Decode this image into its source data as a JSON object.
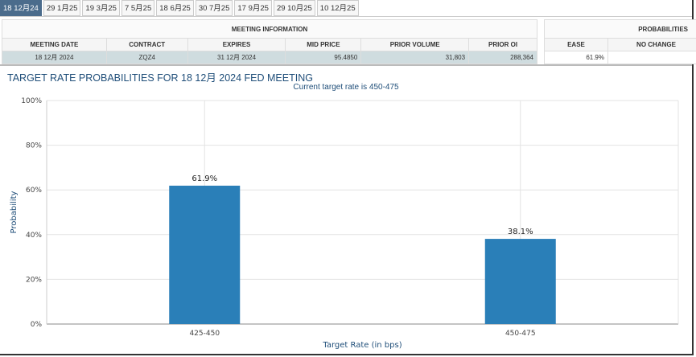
{
  "tabs": [
    "18 12月24",
    "29 1月25",
    "19 3月25",
    "7 5月25",
    "18 6月25",
    "30 7月25",
    "17 9月25",
    "29 10月25",
    "10 12月25"
  ],
  "meeting": {
    "group": "MEETING INFORMATION",
    "headers": [
      "MEETING DATE",
      "CONTRACT",
      "EXPIRES",
      "MID PRICE",
      "PRIOR VOLUME",
      "PRIOR OI"
    ],
    "row": [
      "18 12月 2024",
      "ZQZ4",
      "31 12月 2024",
      "95.4850",
      "31,803",
      "288,364"
    ]
  },
  "probabilities": {
    "group": "PROBABILITIES",
    "headers": [
      "EASE",
      "NO CHANGE"
    ],
    "row": [
      "61.9%",
      ""
    ]
  },
  "title": "TARGET RATE PROBABILITIES FOR 18 12月 2024 FED MEETING",
  "subtitle": "Current target rate is 450-475",
  "chart_data": {
    "type": "bar",
    "categories": [
      "425-450",
      "450-475"
    ],
    "values": [
      61.9,
      38.1
    ],
    "data_labels": [
      "61.9%",
      "38.1%"
    ],
    "xlabel": "Target Rate (in bps)",
    "ylabel": "Probability",
    "ylim": [
      0,
      100
    ],
    "yticks": [
      "0%",
      "20%",
      "40%",
      "60%",
      "80%",
      "100%"
    ],
    "color": "#2a7fb8"
  }
}
